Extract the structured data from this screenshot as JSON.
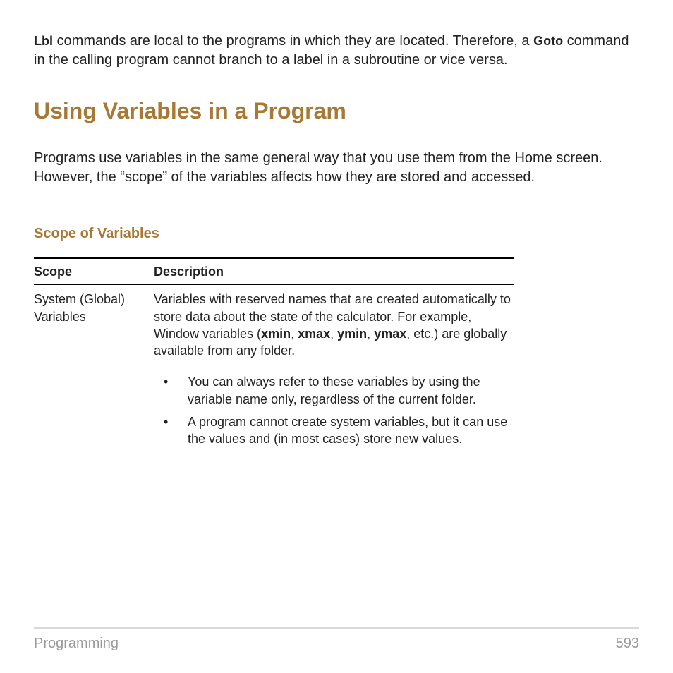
{
  "intro": {
    "cmd1": "Lbl",
    "text1": " commands are local to the programs in which they are located. Therefore, a ",
    "cmd2": "Goto",
    "text2": " command in the calling program cannot branch to a label in a subroutine or vice versa."
  },
  "section_title": "Using Variables in a Program",
  "section_body": "Programs use variables in the same general way that you use them from the Home screen. However, the “scope” of the variables affects how they are stored and accessed.",
  "subhead": "Scope of Variables",
  "table": {
    "headers": {
      "col1": "Scope",
      "col2": "Description"
    },
    "row1": {
      "scope": "System (Global) Variables",
      "desc_pre": "Variables with reserved names that are created automatically to store data about the state of the calculator. For example, Window variables (",
      "b1": "xmin",
      "sep1": ", ",
      "b2": "xmax",
      "sep2": ", ",
      "b3": "ymin",
      "sep3": ", ",
      "b4": "ymax",
      "desc_post": ", etc.) are globally available from any folder.",
      "bullets": [
        "You can always refer to these variables by using the variable name only, regardless of the current folder.",
        "A program cannot create system variables, but it can use the values and (in most cases) store new values."
      ]
    }
  },
  "footer": {
    "chapter": "Programming",
    "page": "593"
  }
}
